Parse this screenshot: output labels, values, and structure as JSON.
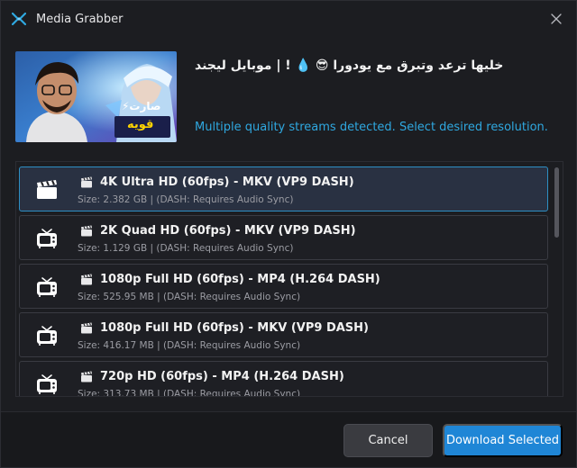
{
  "window": {
    "title": "Media Grabber",
    "accent": "#2d8fc4"
  },
  "header": {
    "video_title": "خليها ترعد وتبرق مع يودورا 😎 💧 ! | موبايل ليجند",
    "thumbnail_caption_line1": "صارت⚡",
    "thumbnail_caption_line2": "قويه",
    "status_message": "Multiple quality streams detected. Select desired resolution."
  },
  "streams": [
    {
      "title": "4K Ultra HD (60fps) - MKV (VP9 DASH)",
      "details": "Size: 2.382 GB | (DASH: Requires Audio Sync)",
      "icon": "clapperboard-icon",
      "selected": true
    },
    {
      "title": "2K Quad HD (60fps) - MKV (VP9 DASH)",
      "details": "Size: 1.129 GB | (DASH: Requires Audio Sync)",
      "icon": "tv-icon",
      "selected": false
    },
    {
      "title": "1080p Full HD (60fps) - MP4 (H.264 DASH)",
      "details": "Size: 525.95 MB | (DASH: Requires Audio Sync)",
      "icon": "tv-icon",
      "selected": false
    },
    {
      "title": "1080p Full HD (60fps) - MKV (VP9 DASH)",
      "details": "Size: 416.17 MB | (DASH: Requires Audio Sync)",
      "icon": "tv-icon",
      "selected": false
    },
    {
      "title": "720p HD (60fps) - MP4 (H.264 DASH)",
      "details": "Size: 313.73 MB | (DASH: Requires Audio Sync)",
      "icon": "tv-icon",
      "selected": false
    }
  ],
  "footer": {
    "cancel_label": "Cancel",
    "download_label": "Download Selected"
  }
}
